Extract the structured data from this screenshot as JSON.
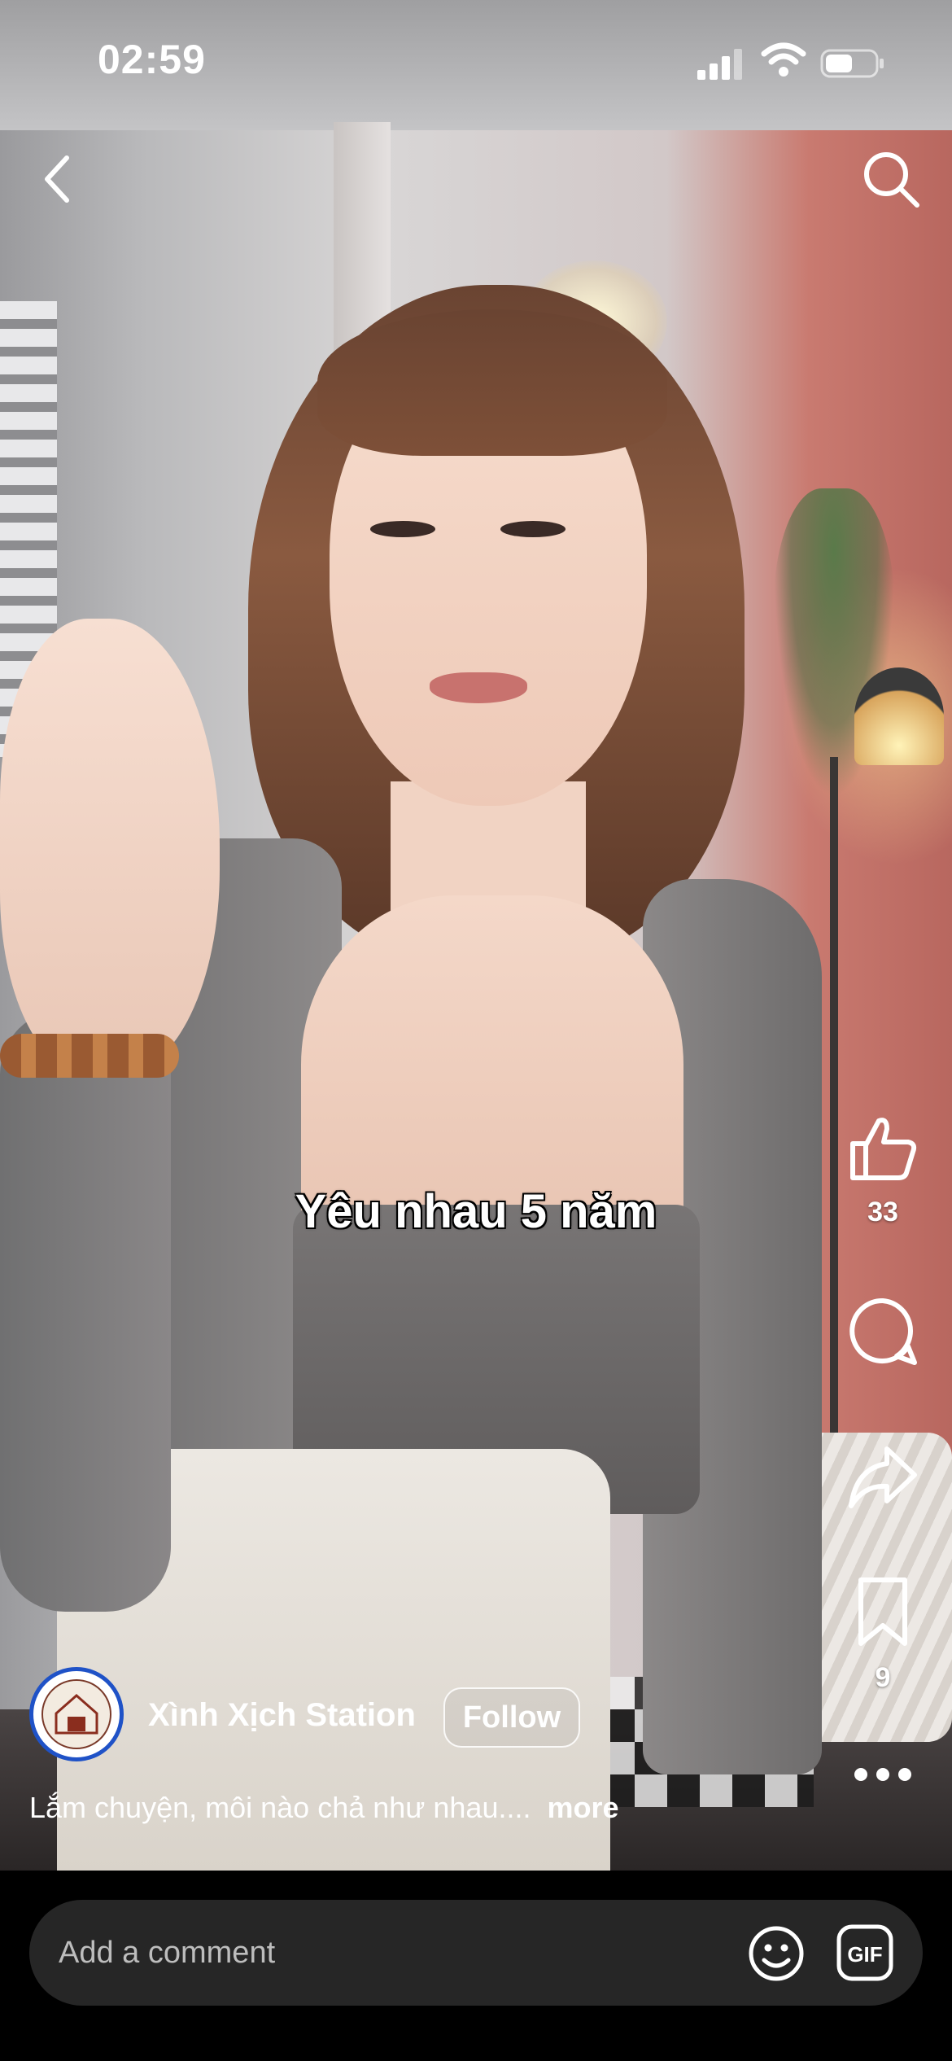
{
  "status_bar": {
    "time": "02:59"
  },
  "video": {
    "overlay_text": "Yêu nhau 5 năm"
  },
  "actions": {
    "like_count": "33",
    "save_count": "9"
  },
  "author": {
    "username": "Xình Xịch Station",
    "follow_label": "Follow"
  },
  "caption": {
    "text": "Lắm chuyện, môi nào chả như nhau....",
    "more_label": "more"
  },
  "comment_bar": {
    "placeholder": "Add a comment",
    "gif_label": "GIF"
  },
  "icons": [
    "back-icon",
    "search-icon",
    "like-icon",
    "comment-icon",
    "share-icon",
    "bookmark-icon",
    "more-icon",
    "emoji-icon",
    "gif-icon",
    "signal-icon",
    "wifi-icon",
    "battery-icon"
  ]
}
